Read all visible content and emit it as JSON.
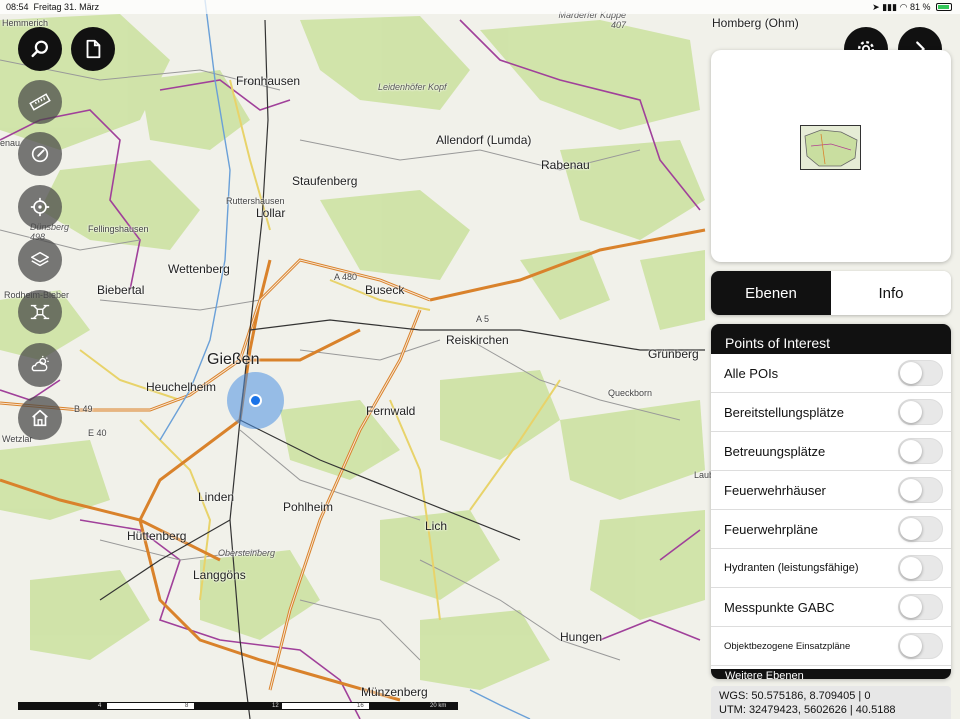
{
  "status_bar": {
    "time": "08:54",
    "date": "Freitag 31. März",
    "battery": "81 %"
  },
  "map": {
    "labels": [
      {
        "text": "Fronhausen",
        "cls": "mid"
      },
      {
        "text": "Leidenhöfer Kopf",
        "cls": "italic"
      },
      {
        "text": "Allendorf (Lumda)",
        "cls": "mid"
      },
      {
        "text": "Rabenau",
        "cls": "mid"
      },
      {
        "text": "Staufenberg",
        "cls": "mid"
      },
      {
        "text": "Ruttershausen",
        "cls": "small"
      },
      {
        "text": "Lollar",
        "cls": "mid"
      },
      {
        "text": "Fellingshausen",
        "cls": "small"
      },
      {
        "text": "Dünsberg 498",
        "cls": "italic"
      },
      {
        "text": "Wettenberg",
        "cls": "mid"
      },
      {
        "text": "Biebertal",
        "cls": "mid"
      },
      {
        "text": "Rodheim-Bieber",
        "cls": "small"
      },
      {
        "text": "A 480",
        "cls": "small"
      },
      {
        "text": "Buseck",
        "cls": "mid"
      },
      {
        "text": "A 5",
        "cls": "small"
      },
      {
        "text": "Reiskirchen",
        "cls": "mid"
      },
      {
        "text": "Grünberg",
        "cls": "mid"
      },
      {
        "text": "Gießen",
        "cls": "big"
      },
      {
        "text": "Heuchelheim",
        "cls": "mid"
      },
      {
        "text": "Queckborn",
        "cls": "small"
      },
      {
        "text": "Fernwald",
        "cls": "mid"
      },
      {
        "text": "Linden",
        "cls": "mid"
      },
      {
        "text": "Pohlheim",
        "cls": "mid"
      },
      {
        "text": "Lich",
        "cls": "mid"
      },
      {
        "text": "Hüttenberg",
        "cls": "mid"
      },
      {
        "text": "Obersteinberg",
        "cls": "italic"
      },
      {
        "text": "Langgöns",
        "cls": "mid"
      },
      {
        "text": "Hungen",
        "cls": "mid"
      },
      {
        "text": "Münzenberg",
        "cls": "mid"
      },
      {
        "text": "Homberg (Ohm)",
        "cls": "mid"
      },
      {
        "text": "Marderfer Kuppe 407",
        "cls": "italic"
      },
      {
        "text": "Hemmerich",
        "cls": "small"
      },
      {
        "text": "enau",
        "cls": "small"
      },
      {
        "text": "Wetzlar",
        "cls": "small"
      },
      {
        "text": "B 49",
        "cls": "small"
      },
      {
        "text": "E 40",
        "cls": "small"
      },
      {
        "text": "Laub",
        "cls": "small"
      }
    ]
  },
  "tabs": {
    "ebenen": "Ebenen",
    "info": "Info"
  },
  "poi": {
    "header": "Points of Interest",
    "items": [
      {
        "label": "Alle POIs",
        "on": false
      },
      {
        "label": "Bereitstellungsplätze",
        "on": false
      },
      {
        "label": "Betreuungsplätze",
        "on": false
      },
      {
        "label": "Feuerwehrhäuser",
        "on": false
      },
      {
        "label": "Feuerwehrpläne",
        "on": false
      },
      {
        "label": "Hydranten (leistungsfähige)",
        "on": false
      },
      {
        "label": "Messpunkte GABC",
        "on": false
      },
      {
        "label": "Objektbezogene Einsatzpläne",
        "on": false
      }
    ],
    "more_header": "Weitere Ebenen"
  },
  "coords": {
    "wgs": "WGS: 50.575186, 8.709405 | 0",
    "utm": "UTM: 32479423, 5602626 | 40.5188"
  },
  "scale": {
    "ticks": [
      "4",
      "8",
      "12",
      "16",
      "20 km"
    ]
  },
  "icons": {
    "search": "search-icon",
    "document": "document-icon",
    "settings": "gear-icon",
    "expand": "chevron-right-icon",
    "measure": "ruler-icon",
    "compass": "compass-icon",
    "locate": "crosshair-icon",
    "layers": "layers-icon",
    "drone": "drone-icon",
    "weather": "weather-icon",
    "home": "home-icon"
  }
}
